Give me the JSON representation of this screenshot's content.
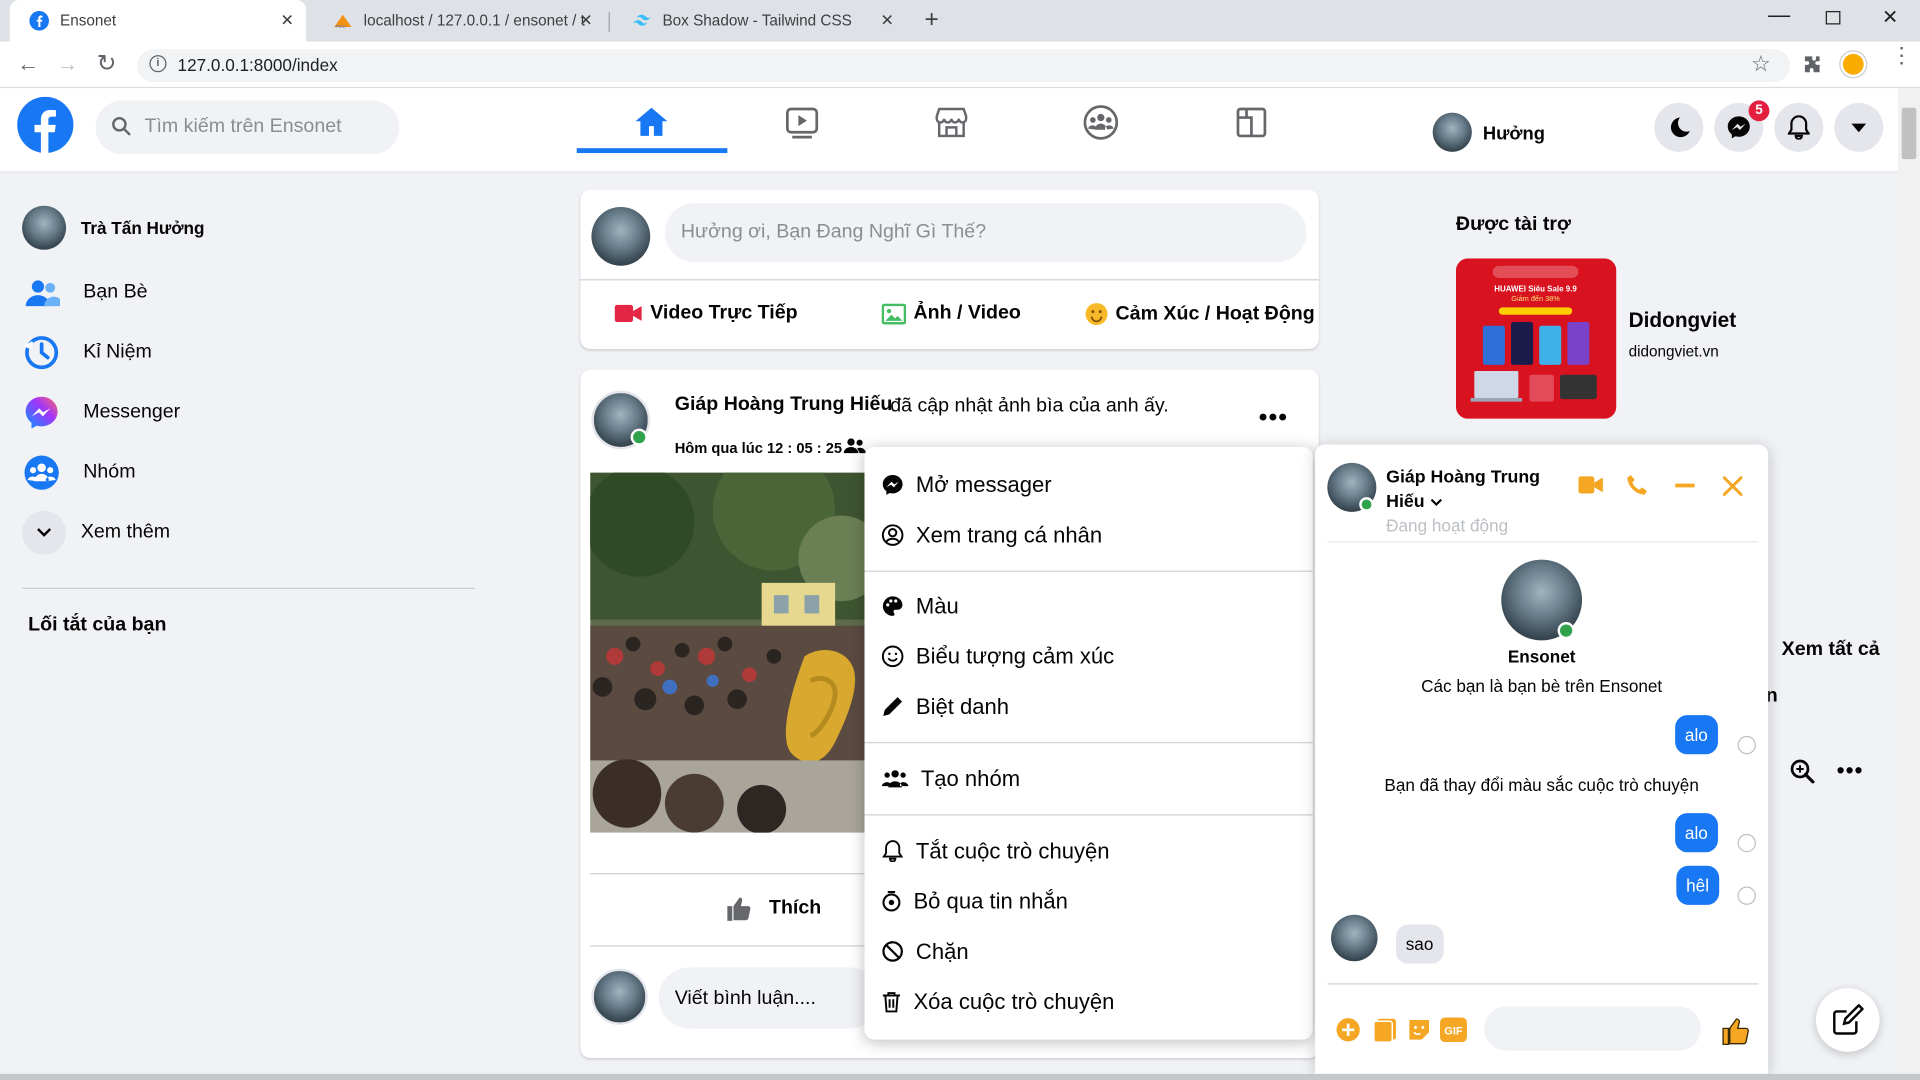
{
  "browser": {
    "tabs": [
      {
        "title": "Ensonet"
      },
      {
        "title": "localhost / 127.0.0.1 / ensonet / t"
      },
      {
        "title": "Box Shadow - Tailwind CSS"
      }
    ],
    "url": "127.0.0.1:8000/index"
  },
  "header": {
    "search_placeholder": "Tìm kiếm trên Ensonet",
    "user_name": "Hưởng",
    "messenger_badge": "5"
  },
  "sidebar": {
    "profile_name": "Trà Tấn Hưởng",
    "items": [
      {
        "label": "Bạn Bè"
      },
      {
        "label": "Kỉ Niệm"
      },
      {
        "label": "Messenger"
      },
      {
        "label": "Nhóm"
      },
      {
        "label": "Xem thêm"
      }
    ],
    "shortcuts_title": "Lối tắt của bạn"
  },
  "composer": {
    "placeholder": "Hưởng ơi, Bạn Đang Nghĩ Gì Thế?",
    "live_label": "Video Trực Tiếp",
    "photo_label": "Ảnh / Video",
    "feeling_label": "Cảm Xúc / Hoạt Động"
  },
  "post": {
    "author": "Giáp Hoàng Trung Hiếu",
    "action": "đã cập nhật ảnh bìa của anh ấy.",
    "time": "Hôm qua lúc 12 : 05 : 25",
    "like_label": "Thích",
    "comment_placeholder": "Viết bình luận...."
  },
  "context_menu": {
    "items": [
      "Mở messager",
      "Xem trang cá nhân",
      "Màu",
      "Biểu tượng cảm xúc",
      "Biệt danh",
      "Tạo nhóm",
      "Tắt cuộc trò chuyện",
      "Bỏ qua tin nhắn",
      "Chặn",
      "Xóa cuộc trò chuyện"
    ]
  },
  "sponsored": {
    "title": "Được tài trợ",
    "name": "Didongviet",
    "domain": "didongviet.vn",
    "ad_text_1": "HUAWEI Siêu Sale 9.9",
    "ad_text_2": "Giảm đến 38%"
  },
  "contacts": {
    "see_all": "Xem tất cả",
    "partial_letter": "n"
  },
  "chat": {
    "name_line1": "Giáp Hoàng Trung",
    "name_line2": "Hiếu",
    "status": "Đang hoạt động",
    "intro_title": "Ensonet",
    "intro_sub": "Các bạn là bạn bè trên Ensonet",
    "messages": [
      {
        "text": "alo"
      },
      {
        "text": "Bạn đã thay đổi màu sắc cuộc trò chuyện"
      },
      {
        "text": "alo"
      },
      {
        "text": "hêl"
      },
      {
        "text": "sao"
      }
    ]
  },
  "colors": {
    "brand": "#1877f2",
    "chat_accent": "#f5a623",
    "online": "#31a24c",
    "badge": "#e41e3f"
  }
}
